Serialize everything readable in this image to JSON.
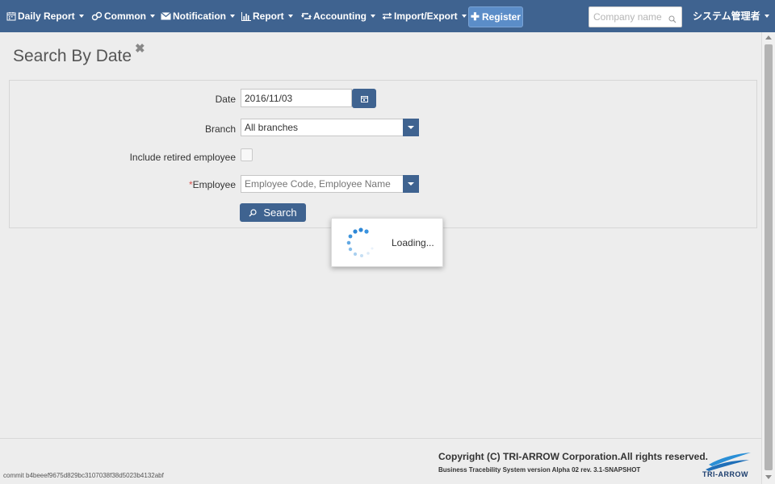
{
  "navbar": {
    "items": [
      {
        "label": "Daily Report",
        "icon": "calendar-icon"
      },
      {
        "label": "Common",
        "icon": "link-icon"
      },
      {
        "label": "Notification",
        "icon": "envelope-icon"
      },
      {
        "label": "Report",
        "icon": "bar-chart-icon"
      },
      {
        "label": "Accounting",
        "icon": "retweet-icon"
      },
      {
        "label": "Import/Export",
        "icon": "exchange-icon"
      }
    ],
    "register_label": "Register",
    "company_search_placeholder": "Company name",
    "user_label": "システム管理者"
  },
  "page": {
    "title": "Search By Date",
    "close_glyph": "✖"
  },
  "form": {
    "date_label": "Date",
    "date_value": "2016/11/03",
    "branch_label": "Branch",
    "branch_value": "All branches",
    "retired_label": "Include retired employee",
    "retired_checked": false,
    "employee_required_mark": "*",
    "employee_label": "Employee",
    "employee_placeholder": "Employee Code, Employee Name",
    "search_label": "Search"
  },
  "loading": {
    "text": "Loading..."
  },
  "footer": {
    "copyright": "Copyright (C) TRI-ARROW Corporation.All rights reserved.",
    "version": "Business Tracebility System version Alpha 02 rev. 3.1-SNAPSHOT",
    "commit": "commit b4beeef9675d829bc3107038f38d5023b4132abf",
    "logo_text": "TRI-ARROW"
  },
  "colors": {
    "navbar": "#3f6390",
    "accent": "#3f6390",
    "register": "#5b8dc8",
    "required": "#d9534f"
  }
}
